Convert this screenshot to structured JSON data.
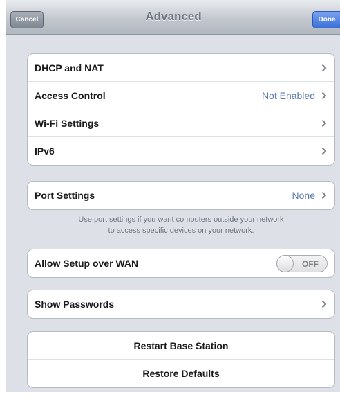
{
  "navbar": {
    "title": "Advanced",
    "cancel_label": "Cancel",
    "done_label": "Done"
  },
  "network_group": [
    {
      "label": "DHCP and NAT",
      "value": ""
    },
    {
      "label": "Access Control",
      "value": "Not Enabled"
    },
    {
      "label": "Wi-Fi Settings",
      "value": ""
    },
    {
      "label": "IPv6",
      "value": ""
    }
  ],
  "port_settings": {
    "label": "Port Settings",
    "value": "None",
    "note_line1": "Use port settings if you want computers outside your network",
    "note_line2": "to access specific devices on your network."
  },
  "wan": {
    "label": "Allow Setup over WAN",
    "toggle_text": "OFF"
  },
  "passwords": {
    "label": "Show Passwords"
  },
  "actions": {
    "restart_label": "Restart Base Station",
    "restore_label": "Restore Defaults"
  },
  "colors": {
    "value_text": "#5a7bb0",
    "highlight_arrow": "#7ad07a"
  }
}
